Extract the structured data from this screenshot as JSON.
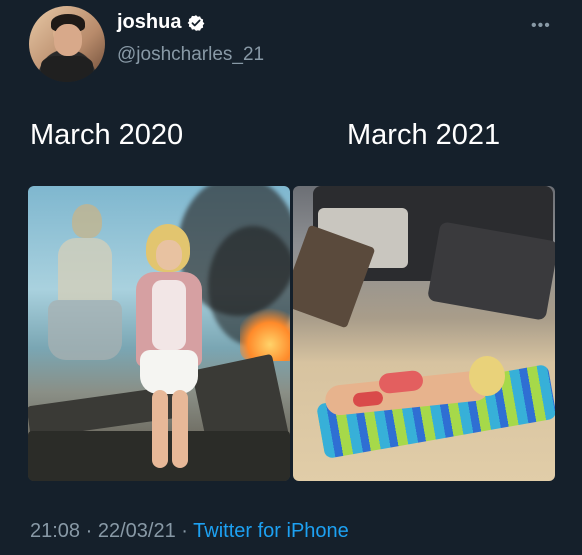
{
  "tweet": {
    "display_name": "joshua",
    "handle": "@joshcharles_21",
    "label_left": "March 2020",
    "label_right": "March 2021",
    "time": "21:08",
    "date": "22/03/21",
    "source": "Twitter for iPhone",
    "separator": "·"
  },
  "icons": {
    "verified": "verified-badge-icon",
    "more": "more-options-icon"
  },
  "colors": {
    "background": "#15202b",
    "secondary_text": "#8899a6",
    "link": "#1da1f2"
  }
}
